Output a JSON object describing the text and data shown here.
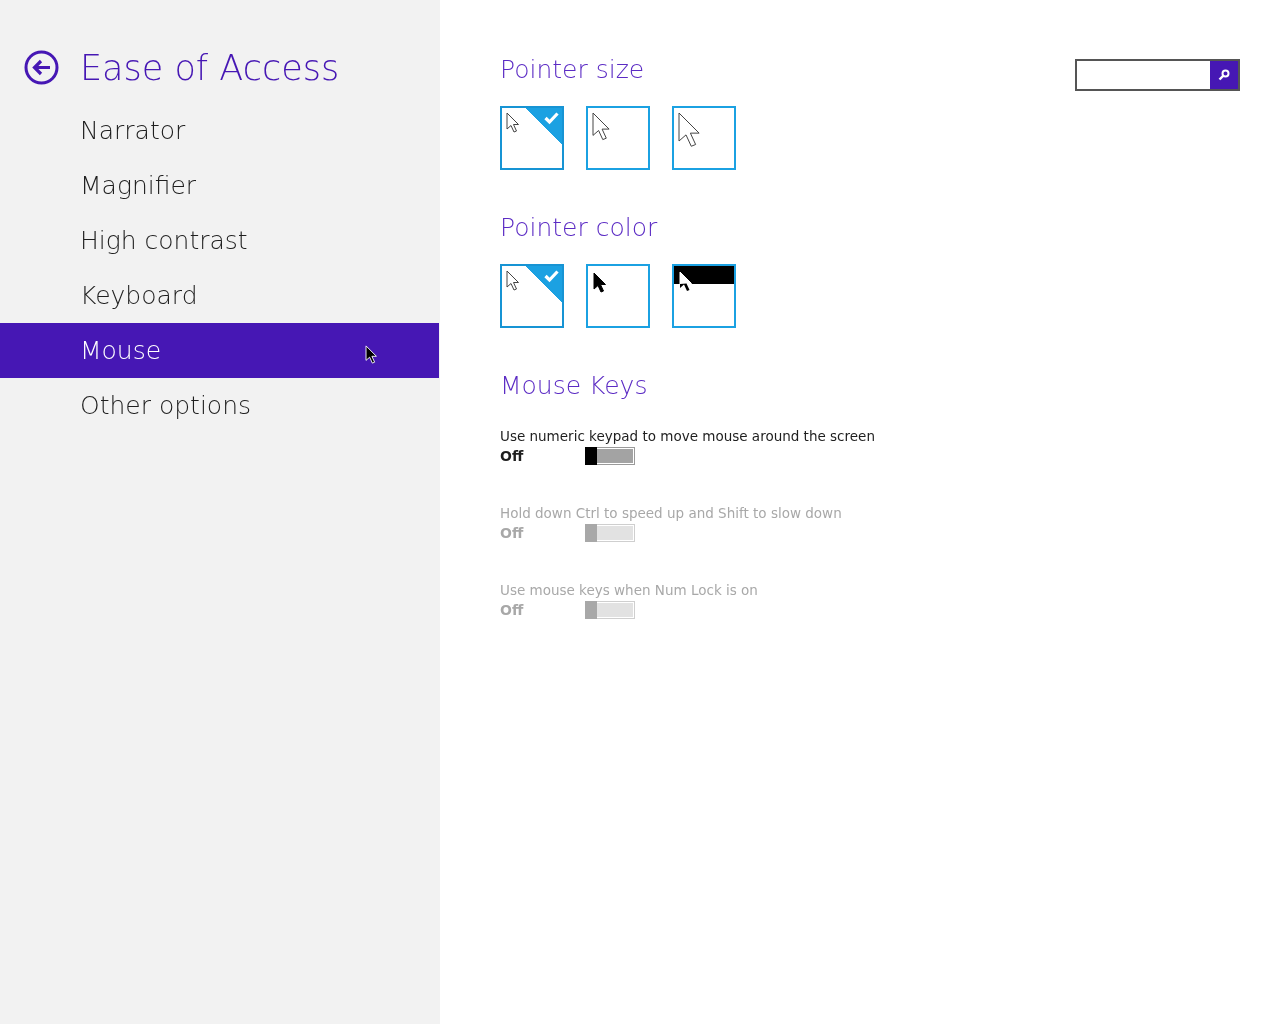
{
  "sidebar": {
    "title": "Ease of Access",
    "items": [
      {
        "label": "Narrator",
        "selected": false
      },
      {
        "label": "Magnifier",
        "selected": false
      },
      {
        "label": "High contrast",
        "selected": false
      },
      {
        "label": "Keyboard",
        "selected": false
      },
      {
        "label": "Mouse",
        "selected": true
      },
      {
        "label": "Other options",
        "selected": false
      }
    ]
  },
  "pointer_size": {
    "heading": "Pointer size",
    "options": [
      {
        "kind": "small",
        "selected": true
      },
      {
        "kind": "medium",
        "selected": false
      },
      {
        "kind": "large",
        "selected": false
      }
    ]
  },
  "pointer_color": {
    "heading": "Pointer color",
    "options": [
      {
        "kind": "white",
        "selected": true
      },
      {
        "kind": "black",
        "selected": false
      },
      {
        "kind": "inverted",
        "selected": false
      }
    ]
  },
  "mouse_keys": {
    "heading": "Mouse Keys",
    "toggles": [
      {
        "label": "Use numeric keypad to move mouse around the screen",
        "state": "Off",
        "on": false,
        "disabled": false
      },
      {
        "label": "Hold down Ctrl to speed up and Shift to slow down",
        "state": "Off",
        "on": false,
        "disabled": true
      },
      {
        "label": "Use mouse keys when Num Lock is on",
        "state": "Off",
        "on": false,
        "disabled": true
      }
    ]
  }
}
